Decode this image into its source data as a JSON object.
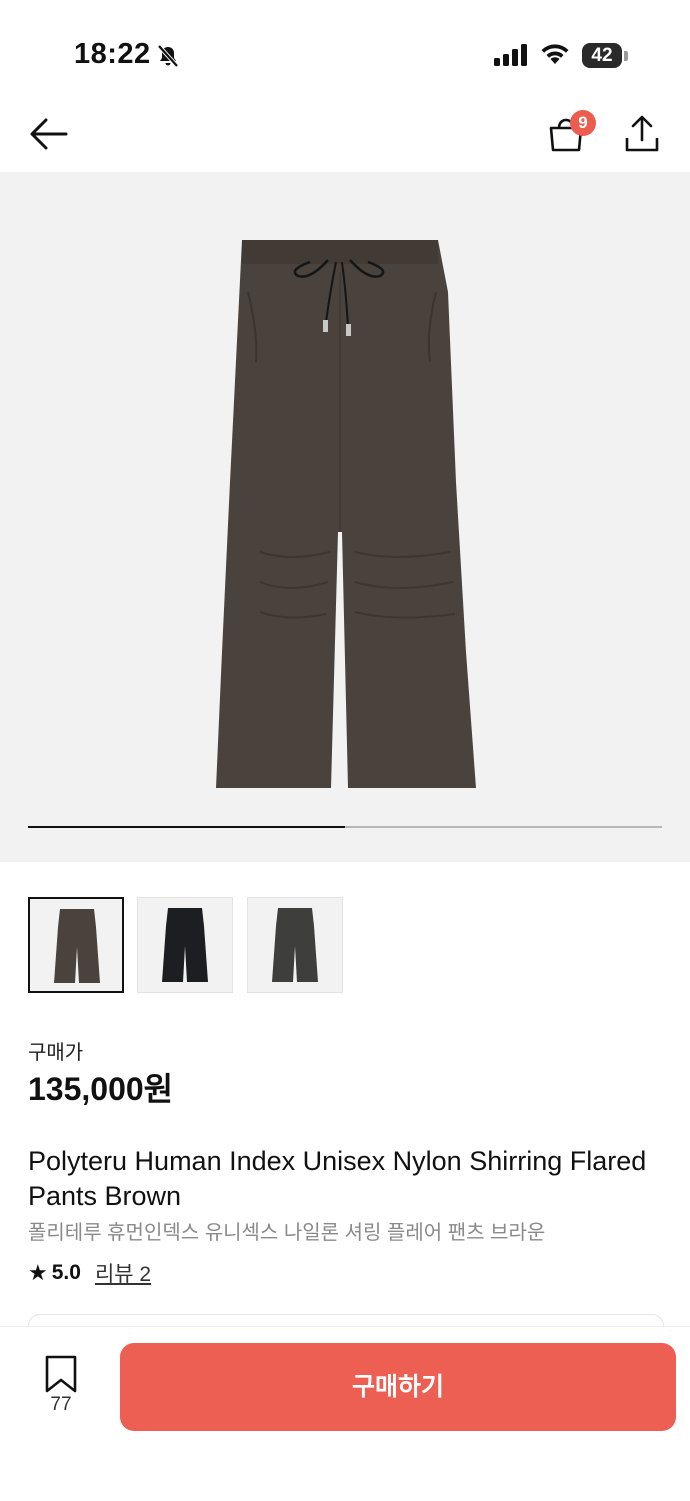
{
  "status_bar": {
    "time": "18:22",
    "battery": "42"
  },
  "header": {
    "cart_count": "9"
  },
  "gallery": {
    "progress": 0.5,
    "image_count": 2
  },
  "thumbnails": [
    {
      "color": "#4a433d",
      "selected": true
    },
    {
      "color": "#1d1e22",
      "selected": false
    },
    {
      "color": "#3e3e3c",
      "selected": false
    }
  ],
  "product": {
    "price_label": "구매가",
    "price": "135,000원",
    "title_en": "Polyteru Human Index Unisex Nylon Shirring Flared Pants Brown",
    "title_ko": "폴리테루 휴먼인덱스 유니섹스 나일론 셔링 플레어 팬츠 브라운",
    "rating": "5.0",
    "reviews_label": "리뷰 2"
  },
  "bottom_bar": {
    "bookmark_count": "77",
    "buy_label": "구매하기"
  },
  "colors": {
    "accent": "#ee5f53",
    "badge": "#ec5c4f",
    "product": "#4a433d"
  }
}
